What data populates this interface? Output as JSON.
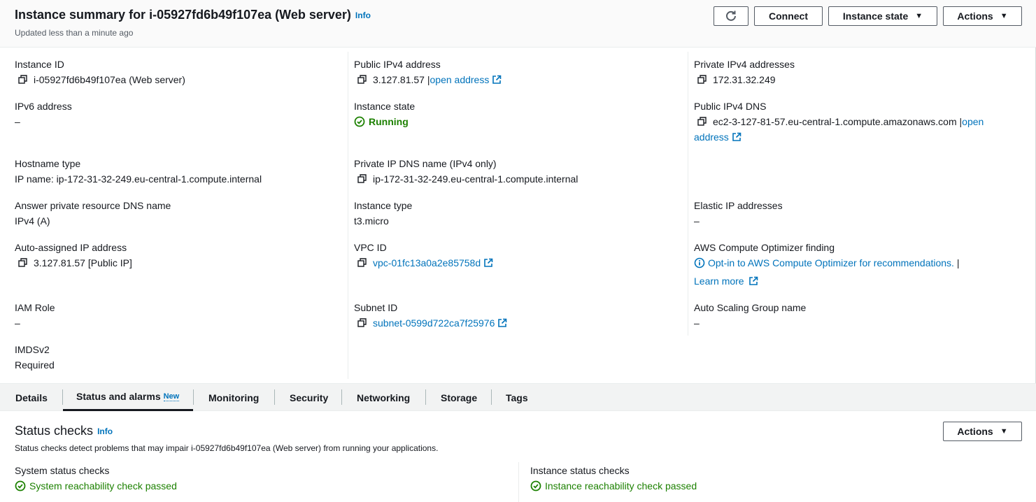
{
  "header": {
    "title": "Instance summary for i-05927fd6b49f107ea (Web server)",
    "info": "Info",
    "updated": "Updated less than a minute ago",
    "connect_label": "Connect",
    "instance_state_label": "Instance state",
    "actions_label": "Actions"
  },
  "fields": {
    "instance_id": {
      "label": "Instance ID",
      "value": "i-05927fd6b49f107ea (Web server)"
    },
    "public_ipv4": {
      "label": "Public IPv4 address",
      "value": "3.127.81.57",
      "sep": "|",
      "link": "open address"
    },
    "private_ipv4": {
      "label": "Private IPv4 addresses",
      "value": "172.31.32.249"
    },
    "ipv6": {
      "label": "IPv6 address",
      "value": "–"
    },
    "instance_state": {
      "label": "Instance state",
      "value": "Running"
    },
    "public_dns": {
      "label": "Public IPv4 DNS",
      "value": "ec2-3-127-81-57.eu-central-1.compute.amazonaws.com",
      "sep": "|",
      "link1": "open",
      "link2": "address"
    },
    "hostname_type": {
      "label": "Hostname type",
      "value": "IP name: ip-172-31-32-249.eu-central-1.compute.internal"
    },
    "private_dns": {
      "label": "Private IP DNS name (IPv4 only)",
      "value": "ip-172-31-32-249.eu-central-1.compute.internal"
    },
    "answer_dns": {
      "label": "Answer private resource DNS name",
      "value": "IPv4 (A)"
    },
    "instance_type": {
      "label": "Instance type",
      "value": "t3.micro"
    },
    "elastic_ip": {
      "label": "Elastic IP addresses",
      "value": "–"
    },
    "auto_ip": {
      "label": "Auto-assigned IP address",
      "value": "3.127.81.57 [Public IP]"
    },
    "vpc_id": {
      "label": "VPC ID",
      "value": "vpc-01fc13a0a2e85758d"
    },
    "optimizer": {
      "label": "AWS Compute Optimizer finding",
      "link": "Opt-in to AWS Compute Optimizer for recommendations.",
      "sep": "|",
      "learn_more": "Learn more"
    },
    "iam_role": {
      "label": "IAM Role",
      "value": "–"
    },
    "subnet_id": {
      "label": "Subnet ID",
      "value": "subnet-0599d722ca7f25976"
    },
    "asg_name": {
      "label": "Auto Scaling Group name",
      "value": "–"
    },
    "imdsv2": {
      "label": "IMDSv2",
      "value": "Required"
    }
  },
  "tabs": [
    {
      "label": "Details"
    },
    {
      "label": "Status and alarms",
      "badge": "New",
      "active": true
    },
    {
      "label": "Monitoring"
    },
    {
      "label": "Security"
    },
    {
      "label": "Networking"
    },
    {
      "label": "Storage"
    },
    {
      "label": "Tags"
    }
  ],
  "status_checks": {
    "title": "Status checks",
    "info": "Info",
    "description": "Status checks detect problems that may impair i-05927fd6b49f107ea (Web server) from running your applications.",
    "actions_label": "Actions",
    "system": {
      "label": "System status checks",
      "value": "System reachability check passed"
    },
    "instance": {
      "label": "Instance status checks",
      "value": "Instance reachability check passed"
    }
  },
  "colors": {
    "link": "#0073bb",
    "success": "#1d8102",
    "text": "#16191f"
  }
}
